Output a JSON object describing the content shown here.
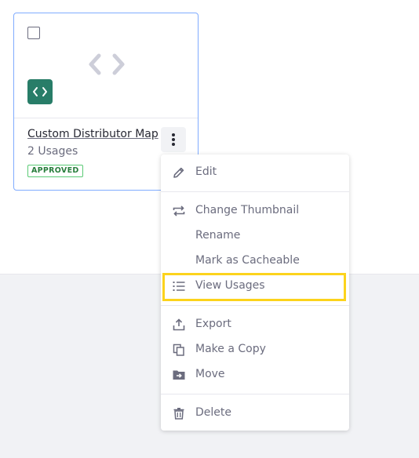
{
  "card": {
    "title": "Custom Distributor Map",
    "subtitle": "2 Usages",
    "status": "APPROVED",
    "thumbnail_icon": "code-icon",
    "type_icon": "code-icon"
  },
  "menu": {
    "items": [
      {
        "label": "Edit",
        "icon": "pencil-icon"
      },
      {
        "label": "Change Thumbnail",
        "icon": "change-icon"
      },
      {
        "label": "Rename",
        "icon": ""
      },
      {
        "label": "Mark as Cacheable",
        "icon": ""
      },
      {
        "label": "View Usages",
        "icon": "list-icon",
        "highlighted": true
      },
      {
        "label": "Export",
        "icon": "export-icon"
      },
      {
        "label": "Make a Copy",
        "icon": "copy-icon"
      },
      {
        "label": "Move",
        "icon": "move-folder-icon"
      },
      {
        "label": "Delete",
        "icon": "trash-icon"
      }
    ]
  },
  "colors": {
    "accent_border": "#80acff",
    "sticker": "#287d68",
    "status_green": "#287d3c",
    "highlight": "#fcd31c"
  }
}
